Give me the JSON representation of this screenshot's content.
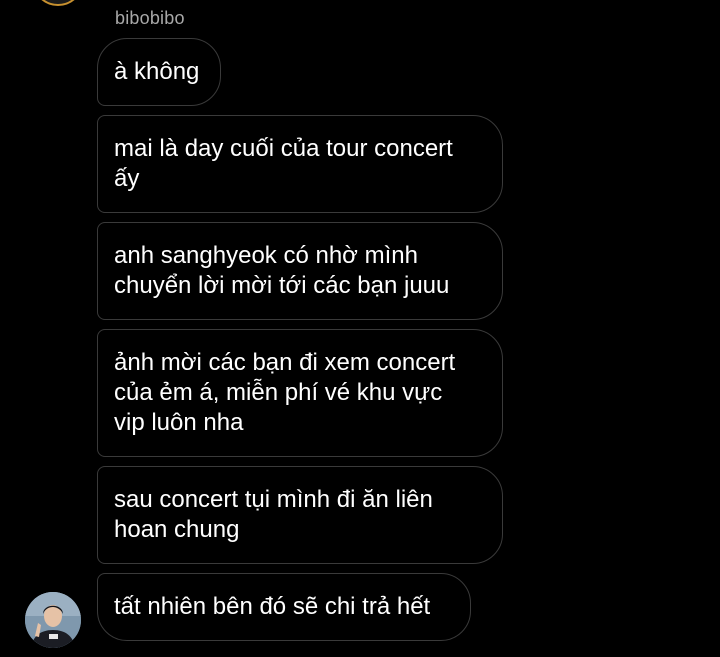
{
  "conversation": {
    "sender_name": "bibobibo",
    "messages": [
      {
        "text": "à không"
      },
      {
        "text": "mai là day cuối của tour concert\nấy"
      },
      {
        "text": "anh sanghyeok có nhờ mình\nchuyển lời mời tới các bạn juuu"
      },
      {
        "text": "ảnh mời các bạn đi xem concert\ncủa ẻm á, miễn phí vé khu vực\nvip luôn nha"
      },
      {
        "text": "sau concert tụi mình đi ăn liên\nhoan chung"
      },
      {
        "text": "tất nhiên bên đó sẽ chi trả hết"
      }
    ]
  },
  "colors": {
    "background": "#000000",
    "bubble_border": "#3a3a3a",
    "message_text": "#ffffff",
    "sender_text": "#a8a8a8"
  },
  "icons": {
    "top_avatar": "avatar-partial-top",
    "sender_avatar": "avatar-photo"
  }
}
